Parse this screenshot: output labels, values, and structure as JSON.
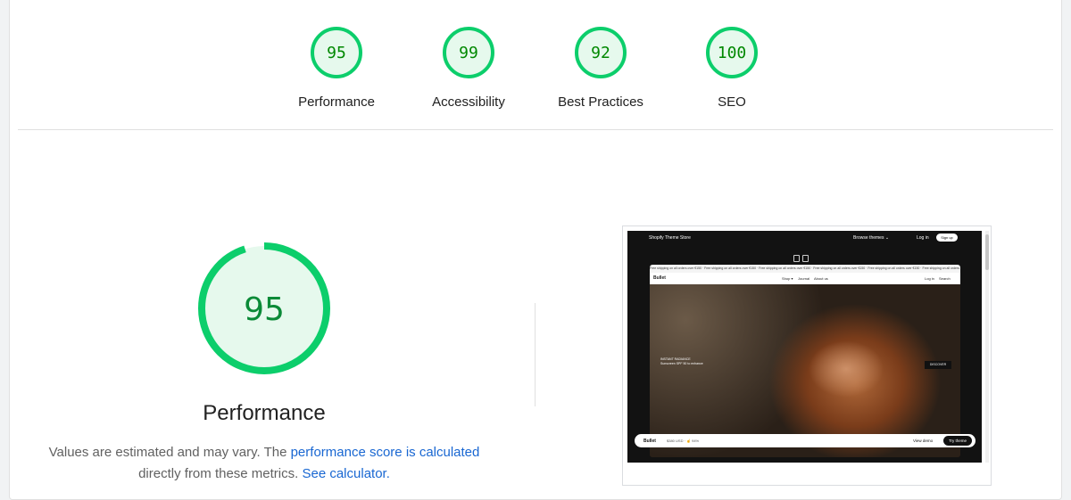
{
  "colors": {
    "pass": "#0cce6b",
    "pass_fill": "#e6f9ed",
    "pass_text": "#008800",
    "link": "#1967d2"
  },
  "scores": [
    {
      "label": "Performance",
      "value": "95",
      "fraction": 0.95
    },
    {
      "label": "Accessibility",
      "value": "99",
      "fraction": 0.99
    },
    {
      "label": "Best Practices",
      "value": "92",
      "fraction": 0.92
    },
    {
      "label": "SEO",
      "value": "100",
      "fraction": 1.0
    }
  ],
  "performance": {
    "score": "95",
    "fraction": 0.95,
    "title": "Performance",
    "desc_before": "Values are estimated and may vary. The ",
    "desc_link": "performance score is calculated",
    "desc_middle": "directly from these metrics.",
    "calc_link": "See calculator."
  },
  "screenshot": {
    "store_title": "Shopify Theme Store",
    "browse": "Browse themes ⌄",
    "login": "Log in",
    "signup": "Sign up",
    "promo": "Free shipping on all orders over €150 · Free shipping on all orders over €150 · Free shipping on all orders over €150 · Free shipping on all orders over €150 · Free shipping on all orders over €150 · Free shipping on all orders over €150",
    "site_logo": "Bullet",
    "site_nav": [
      "Shop ▾",
      "Journal",
      "About us"
    ],
    "site_right": [
      "Log in",
      "Search"
    ],
    "hero_line1": "INSTANT RADIANCE",
    "hero_line2": "Sunscreen SPF 50 to enhance",
    "discover": "DISCOVER",
    "theme_name": "Bullet",
    "theme_meta": "$380 USD · ☝ 94%",
    "view_demo": "View demo",
    "try_theme": "Try theme"
  }
}
